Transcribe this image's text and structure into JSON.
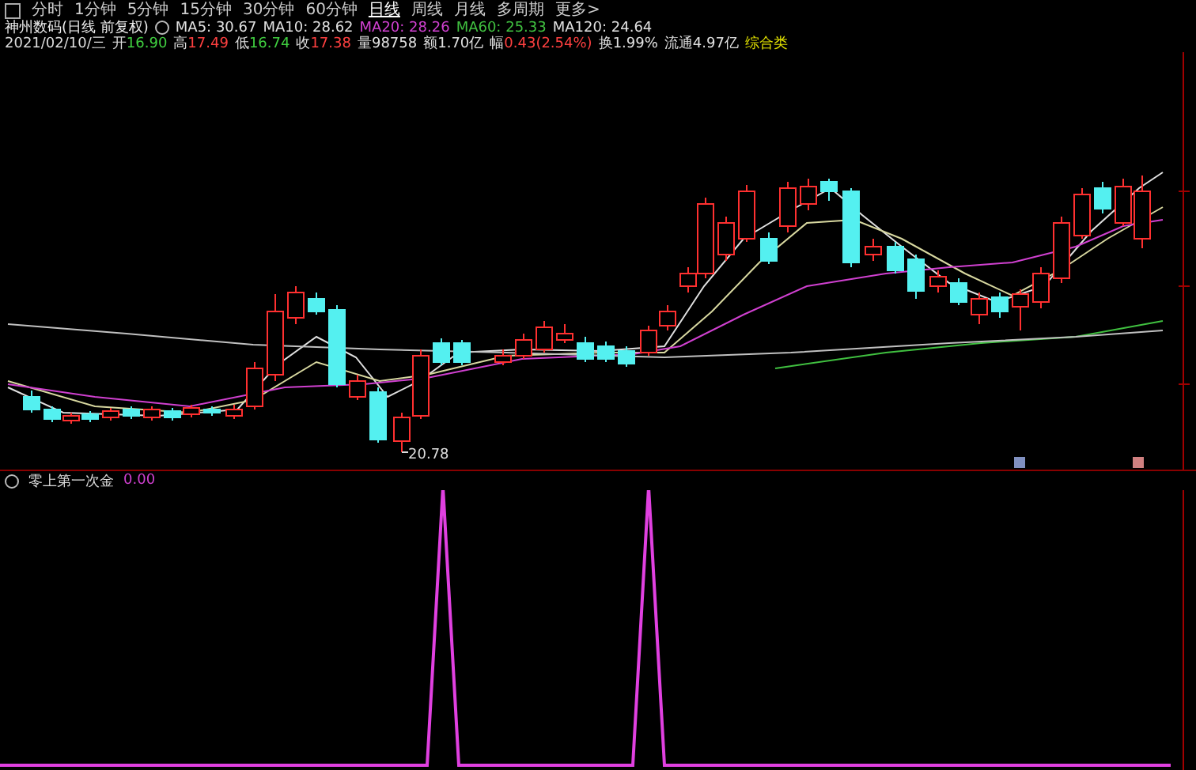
{
  "toolbar": {
    "tabs": [
      {
        "label": "分时",
        "selected": false
      },
      {
        "label": "1分钟",
        "selected": false
      },
      {
        "label": "5分钟",
        "selected": false
      },
      {
        "label": "15分钟",
        "selected": false
      },
      {
        "label": "30分钟",
        "selected": false
      },
      {
        "label": "60分钟",
        "selected": false
      },
      {
        "label": "日线",
        "selected": true
      },
      {
        "label": "周线",
        "selected": false
      },
      {
        "label": "月线",
        "selected": false
      },
      {
        "label": "多周期",
        "selected": false
      },
      {
        "label": "更多>",
        "selected": false
      }
    ]
  },
  "header": {
    "title": "神州数码(日线 前复权)",
    "moving_averages": [
      {
        "label": "MA5:",
        "value": "30.67",
        "color": "#e0e0e0"
      },
      {
        "label": "MA10:",
        "value": "28.62",
        "color": "#e0e0e0"
      },
      {
        "label": "MA20:",
        "value": "28.26",
        "color": "#d040d0"
      },
      {
        "label": "MA60:",
        "value": "25.33",
        "color": "#40c040"
      },
      {
        "label": "MA120:",
        "value": "24.64",
        "color": "#e0e0e0"
      }
    ],
    "date": "2021/02/10/三",
    "quote": [
      {
        "label": "开",
        "value": "16.90",
        "color": "#40d040"
      },
      {
        "label": "高",
        "value": "17.49",
        "color": "#ff4040"
      },
      {
        "label": "低",
        "value": "16.74",
        "color": "#40d040"
      },
      {
        "label": "收",
        "value": "17.38",
        "color": "#ff4040"
      },
      {
        "label": "量",
        "value": "98758",
        "color": "#e0e0e0"
      },
      {
        "label": "额",
        "value": "1.70亿",
        "color": "#e0e0e0"
      },
      {
        "label": "幅",
        "value": "0.43(2.54%)",
        "color": "#ff4040"
      },
      {
        "label": "换",
        "value": "1.99%",
        "color": "#e0e0e0"
      },
      {
        "label": "流通",
        "value": "4.97亿",
        "color": "#e0e0e0"
      },
      {
        "value": "综合类",
        "color": "#e0e000"
      }
    ]
  },
  "chart": {
    "low_label": "20.78"
  },
  "indicator": {
    "name": "零上第一次金",
    "value": "0.00"
  }
}
